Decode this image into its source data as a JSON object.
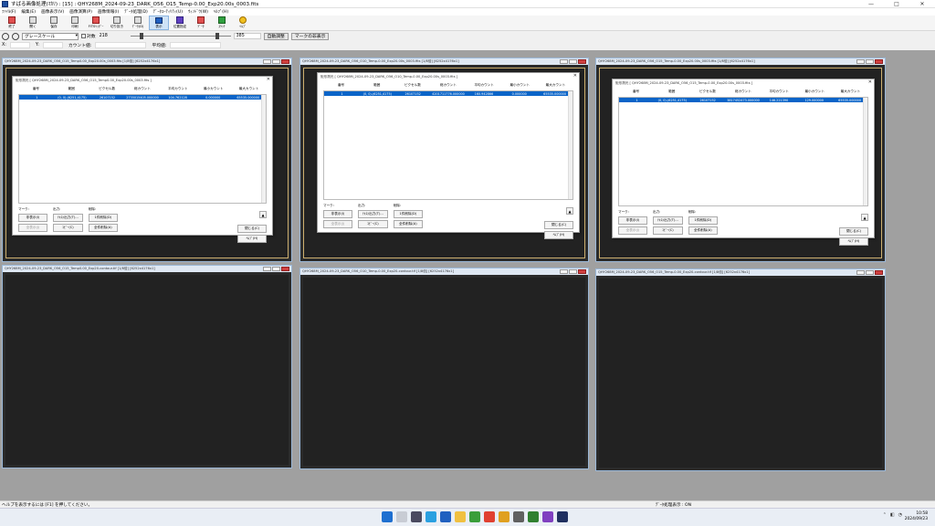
{
  "window": {
    "title": "すばる画像処理(ﾏｶﾘ) : [15] : QHY268M_2024-09-23_DARK_O56_O15_Temp-0.00_Exp20.00s_0003.fits"
  },
  "menu": [
    "ﾌｧｲﾙ(F)",
    "編集(E)",
    "画像表示(V)",
    "画像演算(P)",
    "画像情報(I)",
    "ﾃﾞｰﾀ処理(D)",
    "ﾃﾞｰﾀﾕｰﾃｨﾘﾃｨ(U)",
    "ｳｨﾝﾄﾞｳ(W)",
    "ﾍﾙﾌﾟ(H)"
  ],
  "toolbar": [
    "終了",
    "開く",
    "保存",
    "印刷",
    "FITSﾍｯﾀﾞｰ",
    "切り抜き",
    "ﾃﾞｰﾀ(D)",
    "表示",
    "位置指定",
    "ﾃﾞｰﾀ",
    "ｽｹｯﾁ",
    "ﾍﾙﾌﾟ"
  ],
  "controls": {
    "colormap": "グレースケール",
    "log_label": "対数",
    "low": "218",
    "high": "385",
    "auto_btn": "自動調整",
    "mark_btn": "マークの非表示"
  },
  "infobar": {
    "x": "X:",
    "y": "Y:",
    "count": "カウント値:",
    "avg": "平均値:"
  },
  "windows": {
    "top": [
      "QHY268M_2024-09-23_DARK_O56_O15_Temp0.00_Exp20.00s_0003.fits [1/8倍] [6252x4176x1]",
      "QHY268M_2024-09-23_DARK_O56_O10_Temp-0.00_Exp20.00s_0003.fits [1/8倍] [6252x4176x1]",
      "QHY268M_2024-09-23_DARK_O56_O15_Temp-0.00_Exp20.00s_0003.fits [1/8倍] [6252x4176x1]"
    ],
    "bottom": [
      "QHY268M_2024-09-23_DARK_O56_O15_Temp0.00_Exp20-contour.tif [1/8倍] [6252x4176x1]",
      "QHY268M_2024-09-23_DARK_O56_O10_Temp-0.00_Exp20-contour.tif [1/8倍] [6252x4176x1]",
      "QHY268M_2024-09-23_DARK_O56_O15_Temp-0.00_Exp20-contour.tif [1/8倍] [6252x4176x1]"
    ]
  },
  "dialog": {
    "titles": [
      "矩形測光 [ QHY268M_2024-09-23_DARK_O56_O15_Temp0.00_Exp20.00s_0003.fits ]",
      "矩形測光 [ QHY268M_2024-09-23_DARK_O56_O10_Temp-0.00_Exp20.00s_0003.fits ]",
      "矩形測光 [ QHY268M_2024-09-23_DARK_O56_O15_Temp-0.00_Exp20.00s_0003.fits ]"
    ],
    "headers": [
      "番号",
      "範囲",
      "ピクセル数",
      "総カウント",
      "平均カウント",
      "最小カウント",
      "最大カウント"
    ],
    "rows": [
      [
        "1",
        "(0, 0)-(6251,4175)",
        "26107152",
        "2735015405.000000",
        "104.762128",
        "0.000000",
        "65535.000000"
      ],
      [
        "1",
        "(0, 0)-(6251,4175)",
        "26107152",
        "4201711776.000000",
        "160.942866",
        "0.000000",
        "65535.000000"
      ],
      [
        "1",
        "(0, 0)-(6251,4175)",
        "26107152",
        "3817452473.000000",
        "146.221390",
        "129.000000",
        "65535.000000"
      ]
    ],
    "marker_label": "マーク:",
    "marker_btns": [
      "非表示(I)",
      "全表示(J)"
    ],
    "output_label": "出力:",
    "output_btns": [
      "ﾃｷｽﾄ出力(T)...",
      "ｺﾋﾟｰ(C)"
    ],
    "delete_label": "削除:",
    "delete_btns": [
      "1件削除(D)",
      "全件削除(A)"
    ],
    "close_btn": "閉じる(C)",
    "help_btn": "ﾍﾙﾌﾟ(H)"
  },
  "status": {
    "left": "ヘルプを表示するには [F1] を押してください。",
    "right": "ﾃﾞｰﾀ処理表示 : ON"
  },
  "clock": {
    "time": "10:58",
    "date": "2024/09/23"
  }
}
